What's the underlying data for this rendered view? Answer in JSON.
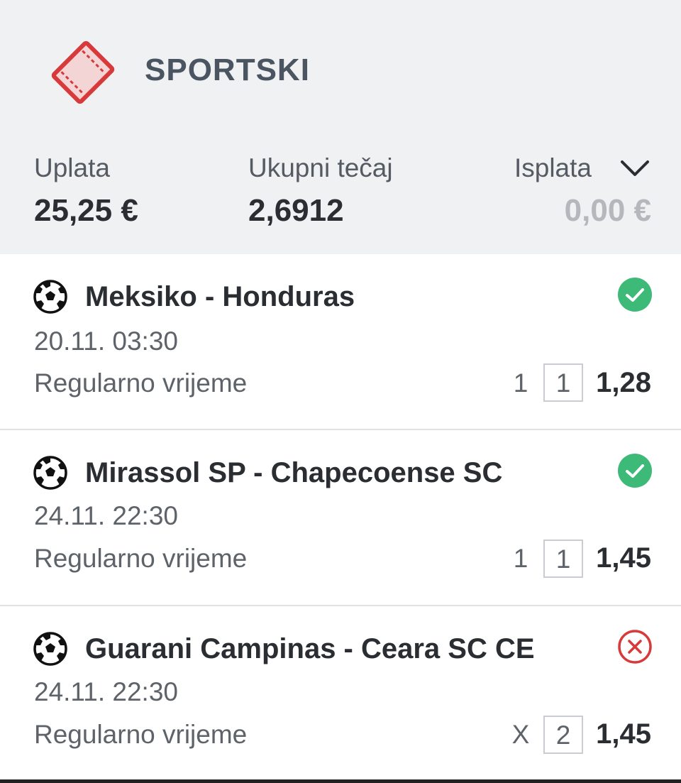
{
  "ticket": {
    "type_label": "SPORTSKI",
    "stake_label": "Uplata",
    "stake_value": "25,25 €",
    "odds_label": "Ukupni tečaj",
    "odds_value": "2,6912",
    "payout_label": "Isplata",
    "payout_value": "0,00 €"
  },
  "matches": [
    {
      "name": "Meksiko - Honduras",
      "date": "20.11. 03:30",
      "market": "Regularno vrijeme",
      "tip": "1",
      "outcome": "1",
      "odds": "1,28",
      "status": "won"
    },
    {
      "name": "Mirassol SP - Chapecoense SC",
      "date": "24.11. 22:30",
      "market": "Regularno vrijeme",
      "tip": "1",
      "outcome": "1",
      "odds": "1,45",
      "status": "won"
    },
    {
      "name": "Guarani Campinas - Ceara SC CE",
      "date": "24.11. 22:30",
      "market": "Regularno vrijeme",
      "tip": "X",
      "outcome": "2",
      "odds": "1,45",
      "status": "lost"
    }
  ],
  "colors": {
    "ticket_red": "#d63a3a",
    "won_green": "#3dba78",
    "lost_red": "#d63a3a"
  },
  "icons": {
    "ticket": "ticket-icon",
    "expand": "chevron-down-icon",
    "sport": "soccer-ball-icon",
    "won": "check-circle-icon",
    "lost": "x-circle-icon"
  }
}
